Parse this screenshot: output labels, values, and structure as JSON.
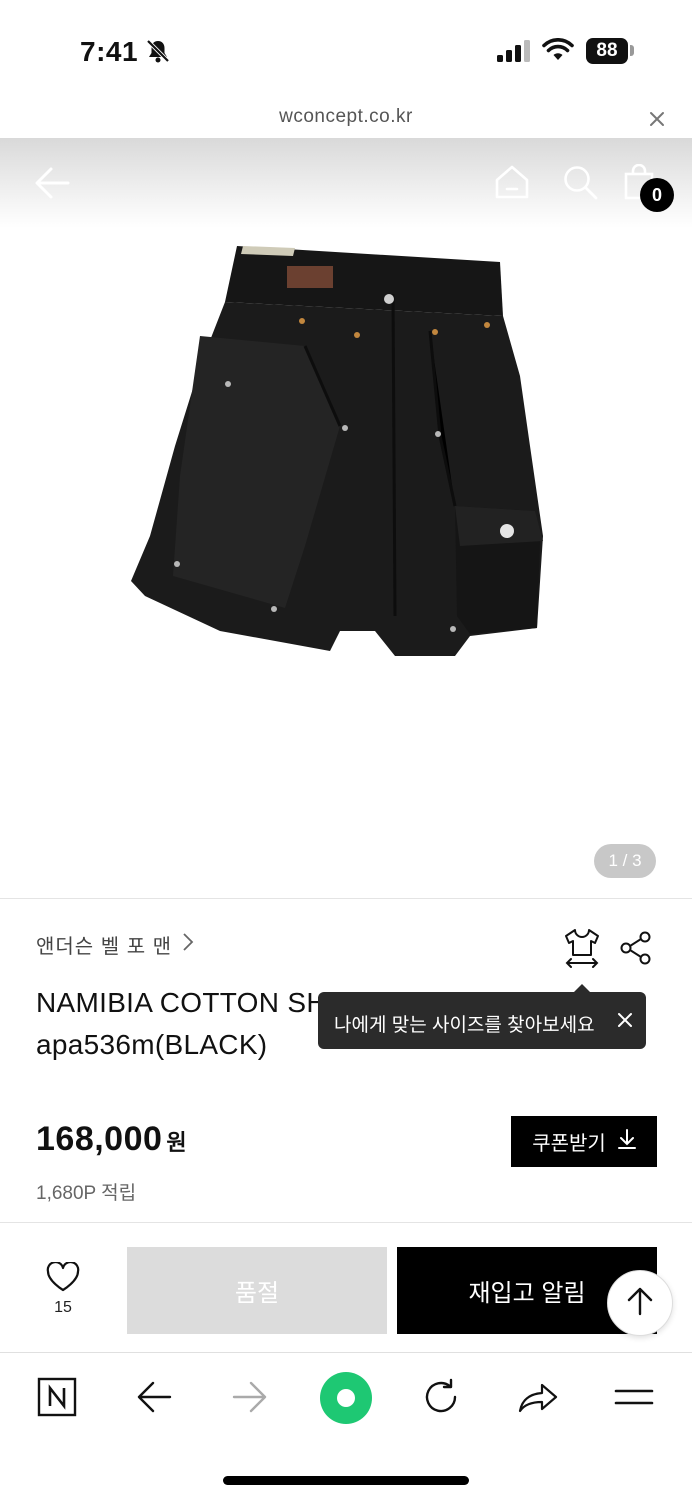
{
  "status_bar": {
    "time": "7:41",
    "battery": "88"
  },
  "browser": {
    "url": "wconcept.co.kr"
  },
  "header": {
    "cart_count": "0"
  },
  "gallery": {
    "indicator": "1 / 3"
  },
  "product": {
    "brand": "앤더슨 벨 포 맨",
    "title": "NAMIBIA COTTON SHORTS apa536m(BLACK)",
    "price": "168,000",
    "currency": "원",
    "points": "1,680P 적립"
  },
  "tooltip": {
    "text": "나에게 맞는 사이즈를 찾아보세요"
  },
  "actions": {
    "coupon_label": "쿠폰받기",
    "wish_count": "15",
    "soldout_label": "품절",
    "restock_label": "재입고 알림"
  },
  "colors": {
    "accent": "#000000",
    "soldout": "#dcdcdc",
    "naver_green": "#1ec800"
  }
}
